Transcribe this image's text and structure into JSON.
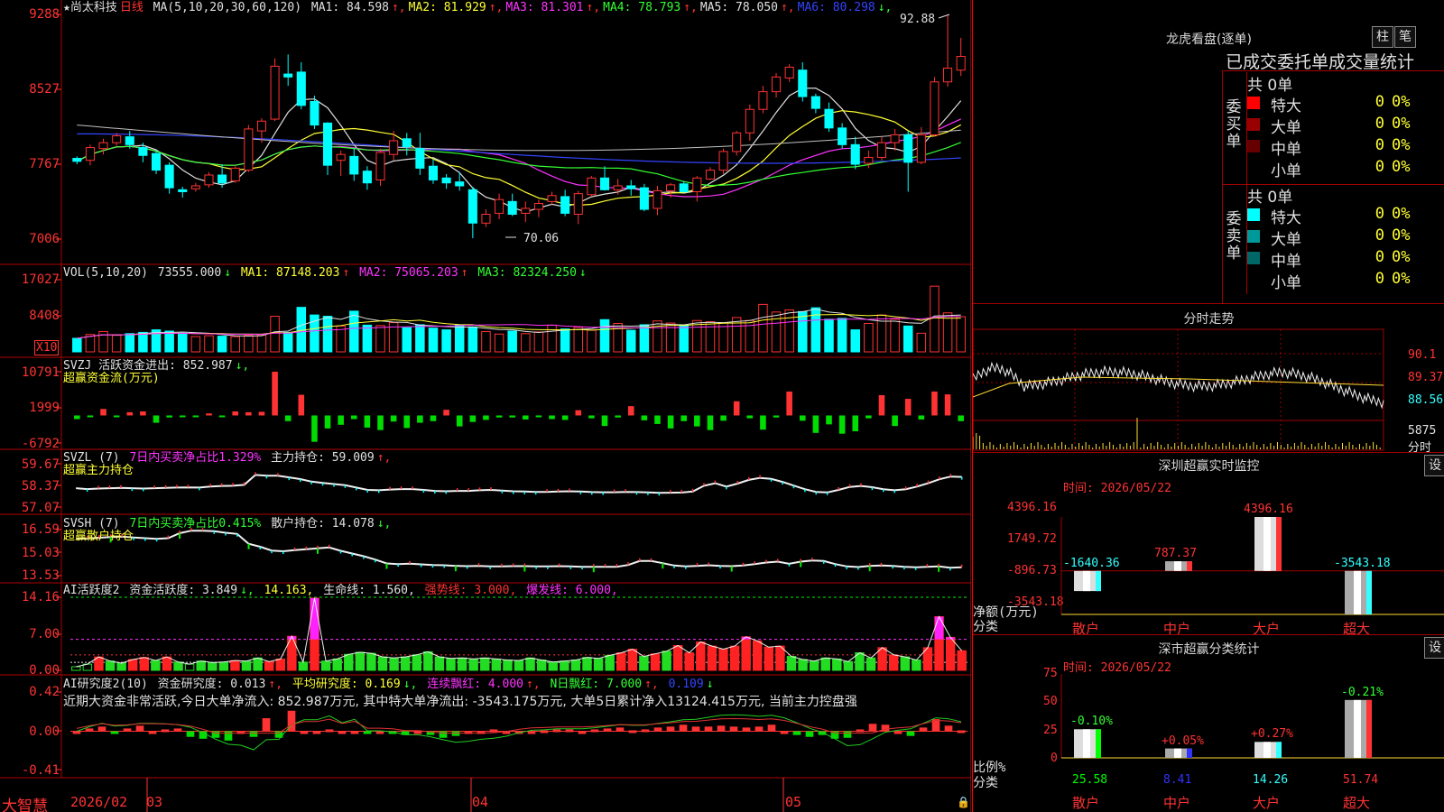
{
  "stock": {
    "name": "★尚太科技",
    "period": "日线",
    "ma_label": "MA(5,10,20,30,60,120)",
    "ma": [
      {
        "label": "MA1:",
        "value": "84.598",
        "arrow": "↑",
        "color": "#e0e0e0"
      },
      {
        "label": "MA2:",
        "value": "81.929",
        "arrow": "↑",
        "color": "#ffff33"
      },
      {
        "label": "MA3:",
        "value": "81.301",
        "arrow": "↑",
        "color": "#ff33ff"
      },
      {
        "label": "MA4:",
        "value": "78.793",
        "arrow": "↑",
        "color": "#33ff33"
      },
      {
        "label": "MA5:",
        "value": "78.050",
        "arrow": "↑",
        "color": "#e0e0e0"
      },
      {
        "label": "MA6:",
        "value": "80.298",
        "arrow": "↓",
        "color": "#3344ff"
      }
    ]
  },
  "price_axis": [
    "9288",
    "8527",
    "7767",
    "7006"
  ],
  "high_label": "92.88",
  "low_label": "70.06",
  "vol": {
    "legend": "VOL(5,10,20)",
    "value": "73555.000",
    "arrow": "↓",
    "ma1": "MA1: 87148.203",
    "ma2": "MA2: 75065.203",
    "ma3": "MA3: 82324.250",
    "axis": [
      "17027",
      "8408"
    ],
    "unit": "X10"
  },
  "svzj": {
    "legend": "SVZJ  活跃资金进出: 852.987",
    "arrow": "↓,",
    "sub": "超赢资金流(万元)",
    "axis": [
      "10791",
      "1999",
      "-6792"
    ]
  },
  "svzl": {
    "name": "SVZL (7)",
    "p1": "7日内买卖净占比1.329%",
    "p2": "主力持仓: 59.009",
    "arrow": "↑,",
    "sub": "超赢主力持仓",
    "axis": [
      "59.67",
      "58.37",
      "57.07"
    ]
  },
  "svsh": {
    "name": "SVSH (7)",
    "p1": "7日内买卖净占比0.415%",
    "p2": "散户持仓: 14.078",
    "arrow": "↓,",
    "sub": "超赢散户持仓",
    "axis": [
      "16.59",
      "15.03",
      "13.53"
    ]
  },
  "ai1": {
    "name": "AI活跃度2",
    "p1": "资金活跃度: 3.849",
    "a1": "↓,",
    "p2": "14.163,",
    "p3": "生命线: 1.560,",
    "p4": "强势线: 3.000,",
    "p5": "爆发线: 6.000,",
    "axis": [
      "14.16",
      "7.00",
      "0.00"
    ]
  },
  "ai2": {
    "name": "AI研究度2(10)",
    "p1": "资金研究度: 0.013",
    "a1": "↑,",
    "p2": "平均研究度: 0.169",
    "a2": "↓,",
    "p3": "连续飘红: 4.000",
    "a3": "↑,",
    "p4": "N日飘红: 7.000",
    "a4": "↑,",
    "p5": "0.109",
    "a5": "↓",
    "note": "近期大资金非常活跃,今日大单净流入: 852.987万元, 其中特大单净流出: -3543.175万元, 大单5日累计净入13124.415万元, 当前主力控盘强",
    "axis": [
      "0.42",
      "0.00",
      "-0.41"
    ]
  },
  "x_axis": [
    "2026/02",
    "03",
    "04",
    "05"
  ],
  "brand": "大智慧",
  "lhb": {
    "title": "龙虎看盘(逐单)",
    "btn1": "柱",
    "btn2": "笔",
    "header": "已成交委托单成交量统计",
    "buy_side": "委买单",
    "sell_side": "委卖单",
    "buy_total": "共 0单",
    "sell_total": "共 0单",
    "buy_rows": [
      {
        "label": "特大",
        "count": "0",
        "pct": "0%",
        "color": "#ff0000"
      },
      {
        "label": "大单",
        "count": "0",
        "pct": "0%",
        "color": "#990000"
      },
      {
        "label": "中单",
        "count": "0",
        "pct": "0%",
        "color": "#660000"
      },
      {
        "label": "小单",
        "count": "0",
        "pct": "0%",
        "color": "#000000"
      }
    ],
    "sell_rows": [
      {
        "label": "特大",
        "count": "0",
        "pct": "0%",
        "color": "#00ffff"
      },
      {
        "label": "大单",
        "count": "0",
        "pct": "0%",
        "color": "#009999"
      },
      {
        "label": "中单",
        "count": "0",
        "pct": "0%",
        "color": "#006666"
      },
      {
        "label": "小单",
        "count": "0",
        "pct": "0%",
        "color": "#000000"
      }
    ]
  },
  "intraday": {
    "title": "分时走势",
    "axis": [
      "90.1",
      "89.37",
      "88.56"
    ],
    "vol_label": "5875",
    "vol_unit": "分时"
  },
  "sz_monitor": {
    "title": "深圳超赢实时监控",
    "btn": "设",
    "time": "时间: 2026/05/22",
    "axis": [
      "4396.16",
      "1749.72",
      "-896.73",
      "-3543.18"
    ],
    "ylabel": "净额(万元)",
    "xlabel": "分类",
    "categories": [
      "散户",
      "中户",
      "大户",
      "超大"
    ],
    "values": [
      "-1640.36",
      "787.37",
      "4396.16",
      "-3543.18"
    ]
  },
  "sz_class": {
    "title": "深市超赢分类统计",
    "btn": "设",
    "time": "时间: 2026/05/22",
    "axis": [
      "75",
      "50",
      "25",
      "0"
    ],
    "ylabel": "比例%",
    "xlabel": "分类",
    "categories": [
      "散户",
      "中户",
      "大户",
      "超大"
    ],
    "values": [
      "25.58",
      "8.41",
      "14.26",
      "51.74"
    ],
    "changes": [
      "-0.10%",
      "+0.05%",
      "+0.27%",
      "-0.21%"
    ]
  },
  "chart_data": [
    {
      "type": "candlestick",
      "title": "尚太科技 日线",
      "ylim": [
        70.06,
        92.88
      ],
      "x": [
        "2026/02",
        "03",
        "04",
        "05"
      ],
      "ohlc": [
        [
          78.2,
          78.4,
          77.6,
          77.9
        ],
        [
          78.0,
          79.6,
          77.5,
          79.3
        ],
        [
          79.2,
          80.2,
          78.6,
          79.8
        ],
        [
          79.8,
          80.8,
          79.5,
          80.5
        ],
        [
          80.4,
          81.0,
          79.2,
          79.6
        ],
        [
          79.3,
          79.8,
          77.8,
          78.5
        ],
        [
          78.7,
          79.0,
          76.6,
          77.0
        ],
        [
          77.5,
          77.8,
          74.6,
          75.2
        ],
        [
          75.0,
          75.3,
          74.2,
          74.8
        ],
        [
          75.1,
          75.7,
          74.8,
          75.4
        ],
        [
          75.5,
          76.8,
          75.2,
          76.5
        ],
        [
          76.5,
          77.6,
          75.2,
          75.7
        ],
        [
          75.9,
          77.4,
          75.7,
          77.2
        ],
        [
          77.0,
          81.6,
          76.8,
          81.2
        ],
        [
          81.0,
          82.3,
          79.8,
          82.0
        ],
        [
          82.2,
          88.4,
          82.0,
          87.6
        ],
        [
          86.8,
          88.8,
          85.6,
          86.5
        ],
        [
          87.0,
          88.0,
          83.2,
          83.6
        ],
        [
          84.0,
          84.6,
          81.2,
          81.6
        ],
        [
          81.8,
          81.9,
          76.5,
          77.5
        ],
        [
          78.0,
          79.0,
          76.4,
          78.6
        ],
        [
          78.4,
          79.3,
          75.9,
          76.6
        ],
        [
          76.9,
          77.4,
          75.0,
          75.7
        ],
        [
          76.0,
          79.2,
          75.4,
          78.8
        ],
        [
          78.6,
          81.0,
          78.0,
          80.0
        ],
        [
          80.2,
          80.8,
          78.5,
          79.4
        ],
        [
          79.2,
          80.8,
          76.5,
          77.2
        ],
        [
          77.4,
          78.1,
          75.6,
          76.0
        ],
        [
          76.2,
          76.6,
          75.1,
          75.7
        ],
        [
          75.8,
          76.8,
          74.9,
          75.4
        ],
        [
          75.0,
          75.3,
          70.06,
          71.6
        ],
        [
          71.6,
          73.0,
          71.2,
          72.5
        ],
        [
          72.6,
          74.6,
          72.0,
          74.0
        ],
        [
          73.8,
          74.6,
          72.3,
          72.5
        ],
        [
          72.6,
          73.8,
          71.7,
          73.1
        ],
        [
          73.0,
          74.0,
          72.2,
          73.6
        ],
        [
          73.8,
          74.8,
          73.5,
          74.4
        ],
        [
          74.3,
          75.0,
          72.3,
          72.6
        ],
        [
          72.5,
          74.9,
          71.5,
          74.6
        ],
        [
          74.5,
          76.4,
          74.3,
          76.2
        ],
        [
          76.2,
          77.4,
          74.9,
          75.0
        ],
        [
          75.0,
          76.1,
          74.5,
          75.4
        ],
        [
          75.4,
          76.0,
          74.4,
          75.1
        ],
        [
          75.2,
          75.6,
          72.8,
          73.0
        ],
        [
          73.1,
          75.4,
          72.4,
          74.9
        ],
        [
          74.9,
          75.7,
          74.2,
          75.5
        ],
        [
          75.6,
          75.9,
          74.7,
          74.8
        ],
        [
          74.8,
          76.4,
          73.8,
          76.2
        ],
        [
          76.1,
          77.3,
          76.0,
          77.0
        ],
        [
          77.0,
          79.2,
          76.6,
          78.9
        ],
        [
          78.9,
          81.0,
          78.5,
          80.8
        ],
        [
          80.8,
          83.7,
          80.0,
          83.2
        ],
        [
          83.2,
          85.6,
          82.8,
          85.0
        ],
        [
          85.0,
          86.9,
          84.4,
          86.5
        ],
        [
          86.4,
          87.8,
          86.0,
          87.5
        ],
        [
          87.2,
          88.0,
          84.0,
          84.5
        ],
        [
          84.5,
          84.8,
          82.8,
          83.3
        ],
        [
          83.2,
          83.9,
          80.9,
          81.3
        ],
        [
          81.3,
          81.8,
          79.2,
          79.6
        ],
        [
          79.6,
          80.4,
          77.1,
          77.6
        ],
        [
          77.7,
          79.0,
          77.2,
          78.3
        ],
        [
          78.3,
          80.4,
          78.0,
          79.8
        ],
        [
          79.8,
          81.2,
          79.0,
          80.6
        ],
        [
          80.6,
          81.0,
          74.8,
          77.8
        ],
        [
          77.8,
          81.4,
          77.6,
          80.6
        ],
        [
          80.6,
          86.5,
          80.4,
          86.0
        ],
        [
          86.0,
          92.88,
          85.5,
          87.4
        ],
        [
          87.2,
          90.5,
          86.6,
          88.6
        ]
      ]
    },
    {
      "type": "bar",
      "title": "VOL(5,10,20)",
      "ylim": [
        0,
        17027
      ],
      "values": [
        3200,
        4100,
        4800,
        3900,
        4300,
        4600,
        5200,
        4900,
        4400,
        3600,
        3800,
        3700,
        3600,
        3900,
        4000,
        8400,
        4600,
        10500,
        8700,
        8400,
        6100,
        9600,
        6300,
        6200,
        6900,
        5700,
        6400,
        5600,
        5200,
        6300,
        5900,
        4800,
        4200,
        4900,
        4300,
        4700,
        6300,
        5400,
        5800,
        5100,
        7600,
        6700,
        5100,
        6400,
        7300,
        6800,
        6300,
        7400,
        7100,
        6900,
        8100,
        7400,
        11200,
        9400,
        9900,
        9500,
        10400,
        7700,
        7900,
        5200,
        6700,
        8700,
        7700,
        6100,
        4400,
        15500,
        9200,
        8300
      ],
      "up": [
        0,
        1,
        1,
        1,
        0,
        0,
        0,
        0,
        0,
        1,
        1,
        0,
        1,
        1,
        1,
        1,
        0,
        0,
        0,
        0,
        1,
        0,
        0,
        1,
        1,
        0,
        0,
        0,
        0,
        0,
        0,
        1,
        1,
        0,
        1,
        1,
        1,
        0,
        1,
        1,
        0,
        1,
        0,
        0,
        1,
        1,
        0,
        1,
        1,
        1,
        1,
        1,
        1,
        1,
        1,
        0,
        0,
        0,
        0,
        0,
        1,
        1,
        1,
        0,
        1,
        1,
        1,
        1
      ]
    },
    {
      "type": "bar",
      "title": "SVZJ 超赢资金流(万元)",
      "ylim": [
        -6792,
        10791
      ],
      "values": [
        -900,
        -400,
        1600,
        -300,
        800,
        1000,
        -1800,
        -500,
        -300,
        -300,
        500,
        -400,
        1000,
        800,
        900,
        10791,
        -1400,
        5100,
        -6500,
        -3200,
        -2300,
        -900,
        -3000,
        -3600,
        -1500,
        -3100,
        -1800,
        -1400,
        1400,
        -2700,
        -1600,
        -1100,
        -500,
        -500,
        -1000,
        -400,
        -900,
        -1100,
        1300,
        -700,
        -2600,
        -500,
        2300,
        -1200,
        -2100,
        -3200,
        -1400,
        -2700,
        -3600,
        -1300,
        3500,
        -700,
        -3500,
        -500,
        5900,
        -1300,
        -4300,
        -2200,
        -4500,
        -3900,
        -700,
        5000,
        -2600,
        4100,
        -1000,
        5900,
        5200,
        -1400
      ]
    },
    {
      "type": "line",
      "title": "SVZL (7) 超赢主力持仓",
      "ylim": [
        57.07,
        59.67
      ],
      "values": [
        58.2,
        58.15,
        58.18,
        58.2,
        58.22,
        58.2,
        58.18,
        58.2,
        58.22,
        58.24,
        58.25,
        58.24,
        58.3,
        58.34,
        58.35,
        58.4,
        59.0,
        58.95,
        58.95,
        58.85,
        58.75,
        58.6,
        58.52,
        58.45,
        58.38,
        58.24,
        58.1,
        58.08,
        58.12,
        58.15,
        58.15,
        58.1,
        58.04,
        58.02,
        58.04,
        58.04,
        58.08,
        58.1,
        58.06,
        58.02,
        58.0,
        57.98,
        57.98,
        58.0,
        58.02,
        58.0,
        57.97,
        57.96,
        57.96,
        57.98,
        57.97,
        57.95,
        57.92,
        57.93,
        57.94,
        58.0,
        58.35,
        58.5,
        58.3,
        58.48,
        58.7,
        58.82,
        58.76,
        58.58,
        58.36,
        58.14,
        57.98,
        57.95,
        58.1,
        58.28,
        58.34,
        58.26,
        58.14,
        58.08,
        58.14,
        58.3,
        58.5,
        58.74,
        58.9,
        58.88
      ]
    },
    {
      "type": "line",
      "title": "SVSH (7) 超赢散户持仓",
      "ylim": [
        13.53,
        16.59
      ],
      "values": [
        15.98,
        16.0,
        16.05,
        16.1,
        16.12,
        16.06,
        16.02,
        15.98,
        16.02,
        16.35,
        16.52,
        16.52,
        16.48,
        16.38,
        16.3,
        15.65,
        15.45,
        15.2,
        15.15,
        15.22,
        15.28,
        15.34,
        15.4,
        15.18,
        15.0,
        14.82,
        14.6,
        14.34,
        14.3,
        14.32,
        14.28,
        14.24,
        14.22,
        14.18,
        14.16,
        14.18,
        14.14,
        14.14,
        14.16,
        14.16,
        14.15,
        14.14,
        14.16,
        14.14,
        14.12,
        14.12,
        14.12,
        14.12,
        14.24,
        14.5,
        14.5,
        14.36,
        14.2,
        14.15,
        14.18,
        14.22,
        14.18,
        14.16,
        14.2,
        14.3,
        14.4,
        14.46,
        14.32,
        14.46,
        14.54,
        14.5,
        14.3,
        14.14,
        14.1,
        14.18,
        14.2,
        14.18,
        14.12,
        14.08,
        14.12,
        14.14,
        14.05,
        14.08
      ]
    },
    {
      "type": "bar",
      "title": "AI活跃度2",
      "ylim": [
        0,
        14.16
      ],
      "values": [
        0.7,
        1.2,
        2.6,
        1.8,
        1.4,
        2.1,
        2.5,
        1.9,
        2.6,
        1.6,
        1.2,
        1.8,
        1.5,
        1.6,
        1.9,
        1.8,
        2.4,
        1.7,
        2.2,
        6.6,
        1.6,
        14.0,
        1.8,
        2.2,
        3.1,
        3.5,
        3.3,
        2.6,
        2.4,
        2.6,
        3.0,
        3.6,
        2.6,
        2.3,
        2.4,
        2.2,
        2.4,
        2.2,
        2.0,
        1.9,
        2.4,
        2.0,
        1.6,
        1.8,
        2.0,
        2.5,
        2.3,
        2.9,
        3.4,
        4.1,
        2.7,
        3.2,
        3.7,
        4.8,
        3.4,
        5.5,
        4.7,
        4.1,
        4.7,
        6.5,
        5.7,
        4.5,
        4.7,
        2.7,
        2.1,
        1.8,
        2.4,
        2.2,
        1.7,
        3.4,
        2.4,
        4.4,
        3.0,
        2.6,
        2.0,
        4.4,
        10.4,
        6.4,
        3.8
      ],
      "up": [
        0,
        0,
        1,
        0,
        0,
        1,
        1,
        0,
        1,
        0,
        0,
        0,
        0,
        0,
        1,
        0,
        0,
        1,
        1,
        1,
        0,
        1,
        0,
        0,
        0,
        0,
        0,
        0,
        0,
        0,
        0,
        0,
        0,
        0,
        0,
        0,
        0,
        0,
        0,
        0,
        0,
        0,
        0,
        0,
        0,
        0,
        0,
        0,
        1,
        1,
        0,
        1,
        0,
        1,
        1,
        1,
        1,
        1,
        1,
        1,
        1,
        1,
        1,
        0,
        0,
        0,
        0,
        0,
        0,
        0,
        0,
        1,
        1,
        0,
        0,
        1,
        1,
        1,
        1
      ]
    },
    {
      "type": "bar",
      "title": "AI研究度2(10)",
      "ylim": [
        -0.41,
        0.42
      ],
      "values": [
        0.0,
        0.03,
        0.05,
        -0.01,
        0.03,
        0.06,
        0.0,
        0.02,
        0.03,
        -0.06,
        -0.08,
        -0.07,
        -0.1,
        0.0,
        -0.06,
        0.14,
        -0.07,
        0.22,
        0.0,
        0.0,
        0.02,
        0.0,
        0.0,
        -0.01,
        0.0,
        -0.02,
        -0.04,
        0.0,
        -0.04,
        -0.07,
        -0.05,
        0.0,
        0.0,
        0.02,
        0.0,
        0.0,
        0.0,
        0.01,
        0.02,
        0.02,
        0.0,
        0.02,
        0.03,
        0.04,
        0.01,
        0.02,
        0.04,
        0.05,
        0.07,
        0.05,
        0.05,
        0.06,
        0.05,
        0.04,
        0.05,
        0.07,
        0.0,
        -0.04,
        -0.06,
        -0.04,
        -0.08,
        -0.07,
        0.02,
        0.08,
        0.07,
        0.0,
        -0.05,
        0.04,
        0.13,
        0.06,
        0.01
      ]
    }
  ]
}
